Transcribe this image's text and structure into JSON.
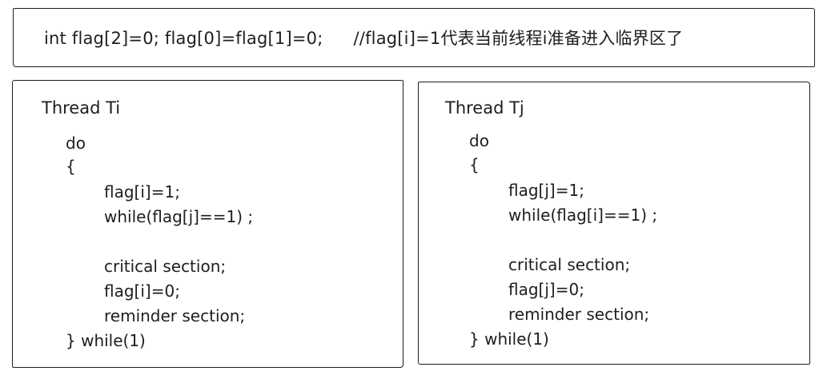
{
  "header": {
    "code": "int flag[2]=0; flag[0]=flag[1]=0;",
    "comment": "//flag[i]=1代表当前线程i准备进入临界区了"
  },
  "thread_i": {
    "title": "Thread Ti",
    "lines": [
      "do",
      "{",
      "flag[i]=1;",
      "while(flag[j]==1) ;",
      "critical section;",
      "flag[i]=0;",
      "reminder section;",
      "} while(1)"
    ]
  },
  "thread_j": {
    "title": "Thread Tj",
    "lines": [
      "do",
      "{",
      "flag[j]=1;",
      "while(flag[i]==1) ;",
      "critical section;",
      "flag[j]=0;",
      "reminder section;",
      "} while(1)"
    ]
  }
}
